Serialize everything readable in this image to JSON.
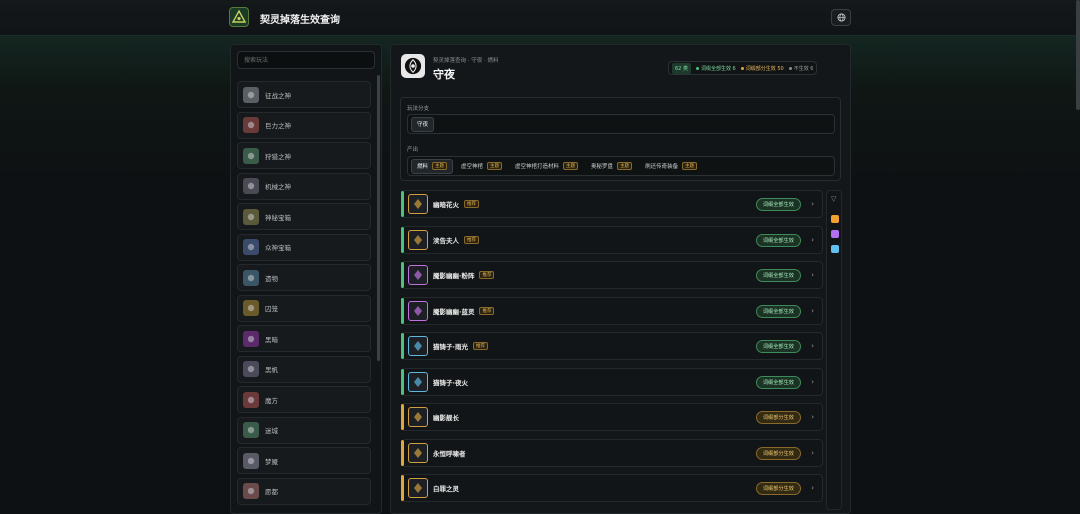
{
  "app": {
    "title": "契灵掉落生效查询"
  },
  "sidebar": {
    "search_placeholder": "搜索玩法",
    "items": [
      {
        "label": "征战之神",
        "icon": "war-god-icon",
        "color": "#5a5f66"
      },
      {
        "label": "巨力之神",
        "icon": "might-god-icon",
        "color": "#6a3a3a"
      },
      {
        "label": "狩猎之神",
        "icon": "hunt-god-icon",
        "color": "#3a5a4a"
      },
      {
        "label": "机械之神",
        "icon": "machine-god-icon",
        "color": "#4a4a55"
      },
      {
        "label": "神秘宝箱",
        "icon": "mystery-chest-icon",
        "color": "#5a5a3a"
      },
      {
        "label": "众神宝箱",
        "icon": "gods-chest-icon",
        "color": "#3a4a6a"
      },
      {
        "label": "遗物",
        "icon": "relic-icon",
        "color": "#3a5566"
      },
      {
        "label": "囚笼",
        "icon": "cage-icon",
        "color": "#6a5a2a"
      },
      {
        "label": "黑暗",
        "icon": "darkness-icon",
        "color": "#5a2a6a"
      },
      {
        "label": "黑帆",
        "icon": "black-sail-icon",
        "color": "#4a4a5a"
      },
      {
        "label": "魔方",
        "icon": "magic-cube-icon",
        "color": "#6a3a3a"
      },
      {
        "label": "迷城",
        "icon": "maze-city-icon",
        "color": "#3a5a4a"
      },
      {
        "label": "梦魇",
        "icon": "nightmare-icon",
        "color": "#5a5a66"
      },
      {
        "label": "愿都",
        "icon": "wish-city-icon",
        "color": "#6a4a4a"
      }
    ]
  },
  "header": {
    "breadcrumb": "契灵掉落查询 · 守夜 · 燃料",
    "title": "守夜",
    "stats": {
      "count": "62 类",
      "full": "词缀全部生效 6",
      "partial": "词缀部分生效 50",
      "none": "不生效 6"
    },
    "colors": {
      "full": "#4ec27a",
      "partial": "#e0a83a",
      "none": "#8a8f92"
    }
  },
  "filters": {
    "branch_label": "玩法分支",
    "branches": [
      {
        "label": "守夜"
      }
    ],
    "output_label": "产出",
    "outputs": [
      {
        "label": "燃料",
        "tag": "主题",
        "active": true
      },
      {
        "label": "虚空神棺",
        "tag": "主题",
        "active": false
      },
      {
        "label": "虚空神棺打造材料",
        "tag": "主题",
        "active": false
      },
      {
        "label": "奥秘罗盘",
        "tag": "主题",
        "active": false
      },
      {
        "label": "刷还传奇装备",
        "tag": "主题",
        "active": false
      }
    ]
  },
  "rows": [
    {
      "name": "幽暗花火",
      "tag": "推荐",
      "status": "词缀全部生效",
      "kind": "full",
      "rarity": "#d0a040",
      "icon": "dark-firework-icon"
    },
    {
      "name": "渎告夫人",
      "tag": "推荐",
      "status": "词缀全部生效",
      "kind": "full",
      "rarity": "#d0a040",
      "icon": "madam-icon"
    },
    {
      "name": "魇影幽幽·粉阵",
      "tag": "推荐",
      "status": "词缀全部生效",
      "kind": "full",
      "rarity": "#c070e0",
      "icon": "shadow-pink-icon"
    },
    {
      "name": "魇影幽幽·蓝灵",
      "tag": "推荐",
      "status": "词缀全部生效",
      "kind": "full",
      "rarity": "#c070e0",
      "icon": "shadow-blue-icon"
    },
    {
      "name": "猫铸子·雨光",
      "tag": "推荐",
      "status": "词缀全部生效",
      "kind": "full",
      "rarity": "#60b8e0",
      "icon": "cat-rain-icon"
    },
    {
      "name": "猫铸子·夜火",
      "tag": "",
      "status": "词缀全部生效",
      "kind": "full",
      "rarity": "#60b8e0",
      "icon": "cat-night-icon"
    },
    {
      "name": "幽影舰长",
      "tag": "",
      "status": "词缀部分生效",
      "kind": "part",
      "rarity": "#d0a040",
      "icon": "ghost-captain-icon"
    },
    {
      "name": "永恒呼啸者",
      "tag": "",
      "status": "词缀部分生效",
      "kind": "part",
      "rarity": "#d0a040",
      "icon": "eternal-howler-icon"
    },
    {
      "name": "白罪之灵",
      "tag": "",
      "status": "词缀部分生效",
      "kind": "part",
      "rarity": "#d0a040",
      "icon": "white-sin-spirit-icon"
    }
  ],
  "rail": {
    "swatches": [
      "#f0a030",
      "#b070f0",
      "#60c0f0"
    ]
  }
}
